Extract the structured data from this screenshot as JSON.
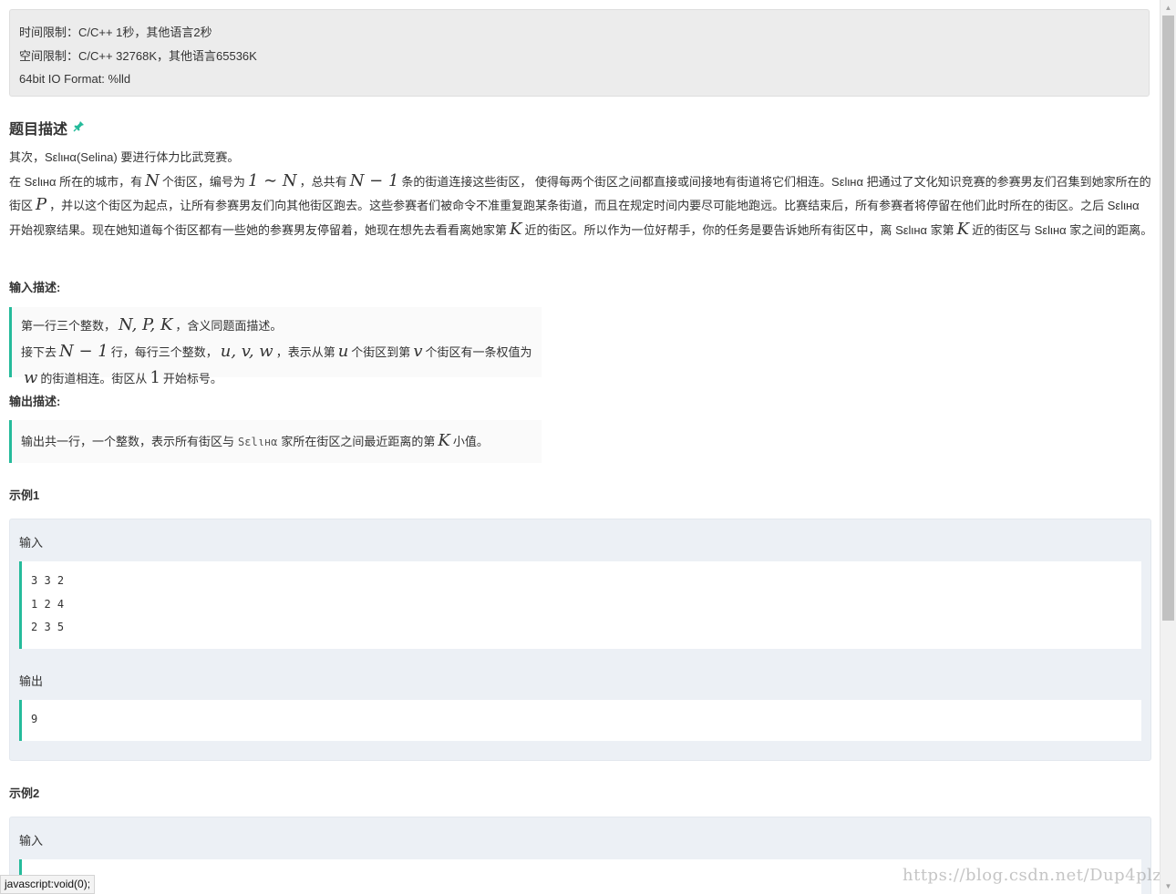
{
  "limits": {
    "time": "时间限制：C/C++ 1秒，其他语言2秒",
    "space": "空间限制：C/C++ 32768K，其他语言65536K",
    "io": "64bit IO Format: %lld"
  },
  "problem": {
    "title": "题目描述",
    "title_icon": "pin-icon",
    "line1": "其次，Sεlιнα(Selina) 要进行体力比武竞赛。",
    "p2_a": "在 Sεlιнα 所在的城市，有",
    "p2_m1": "N",
    "p2_b": "个街区，编号为",
    "p2_m2": "1 ∼ N",
    "p2_c": "，总共有",
    "p2_m3": "N − 1",
    "p2_d": "条的街道连接这些街区， 使得每两个街区之间都直接或间接地有街道将它们相连。Sεlιнα 把通过了文化知识竞赛的参赛男友们召集到她家所在的街区",
    "p2_m4": "P",
    "p2_e": "，并以这个街区为起点，让所有参赛男友们向其他街区跑去。这些参赛者们被命令不准重复跑某条街道，而且在规定时间内要尽可能地跑远。比赛结束后，所有参赛者将停留在他们此时所在的街区。之后 Sεlιнα 开始视察结果。现在她知道每个街区都有一些她的参赛男友停留着，她现在想先去看看离她家第",
    "p2_m5": "K",
    "p2_f": "近的街区。所以作为一位好帮手，你的任务是要告诉她所有街区中，离 Sεlιнα 家第",
    "p2_m6": "K",
    "p2_g": "近的街区与 Sεlιнα 家之间的距离。"
  },
  "input": {
    "title": "输入描述:",
    "l1_a": "第一行三个整数，",
    "l1_m": "N, P, K",
    "l1_b": "，含义同题面描述。",
    "l2_a": "接下去",
    "l2_m1": "N − 1",
    "l2_b": "行，每行三个整数，",
    "l2_m2": "u, v, w",
    "l2_c": "，表示从第",
    "l2_m3": "u",
    "l2_d": "个街区到第",
    "l2_m4": "v",
    "l2_e": "个街区有一条权值为",
    "l2_m5": "w",
    "l2_f": "的街道相连。街区从",
    "l2_m6": "1",
    "l2_g": "开始标号。"
  },
  "output": {
    "title": "输出描述:",
    "l1_a": "输出共一行，一个整数，表示所有街区与",
    "l1_code": "Sεlιнα",
    "l1_b": "家所在街区之间最近距离的第",
    "l1_m": "K",
    "l1_c": "小值。"
  },
  "example1": {
    "title": "示例1",
    "input_label": "输入",
    "input_lines": [
      "3 3 2",
      "1 2 4",
      "2 3 5"
    ],
    "output_label": "输出",
    "output_lines": [
      "9"
    ]
  },
  "example2": {
    "title": "示例2",
    "input_label": "输入"
  },
  "statusbar": "javascript:void(0);",
  "watermark": "https://blog.csdn.net/Dup4plz"
}
